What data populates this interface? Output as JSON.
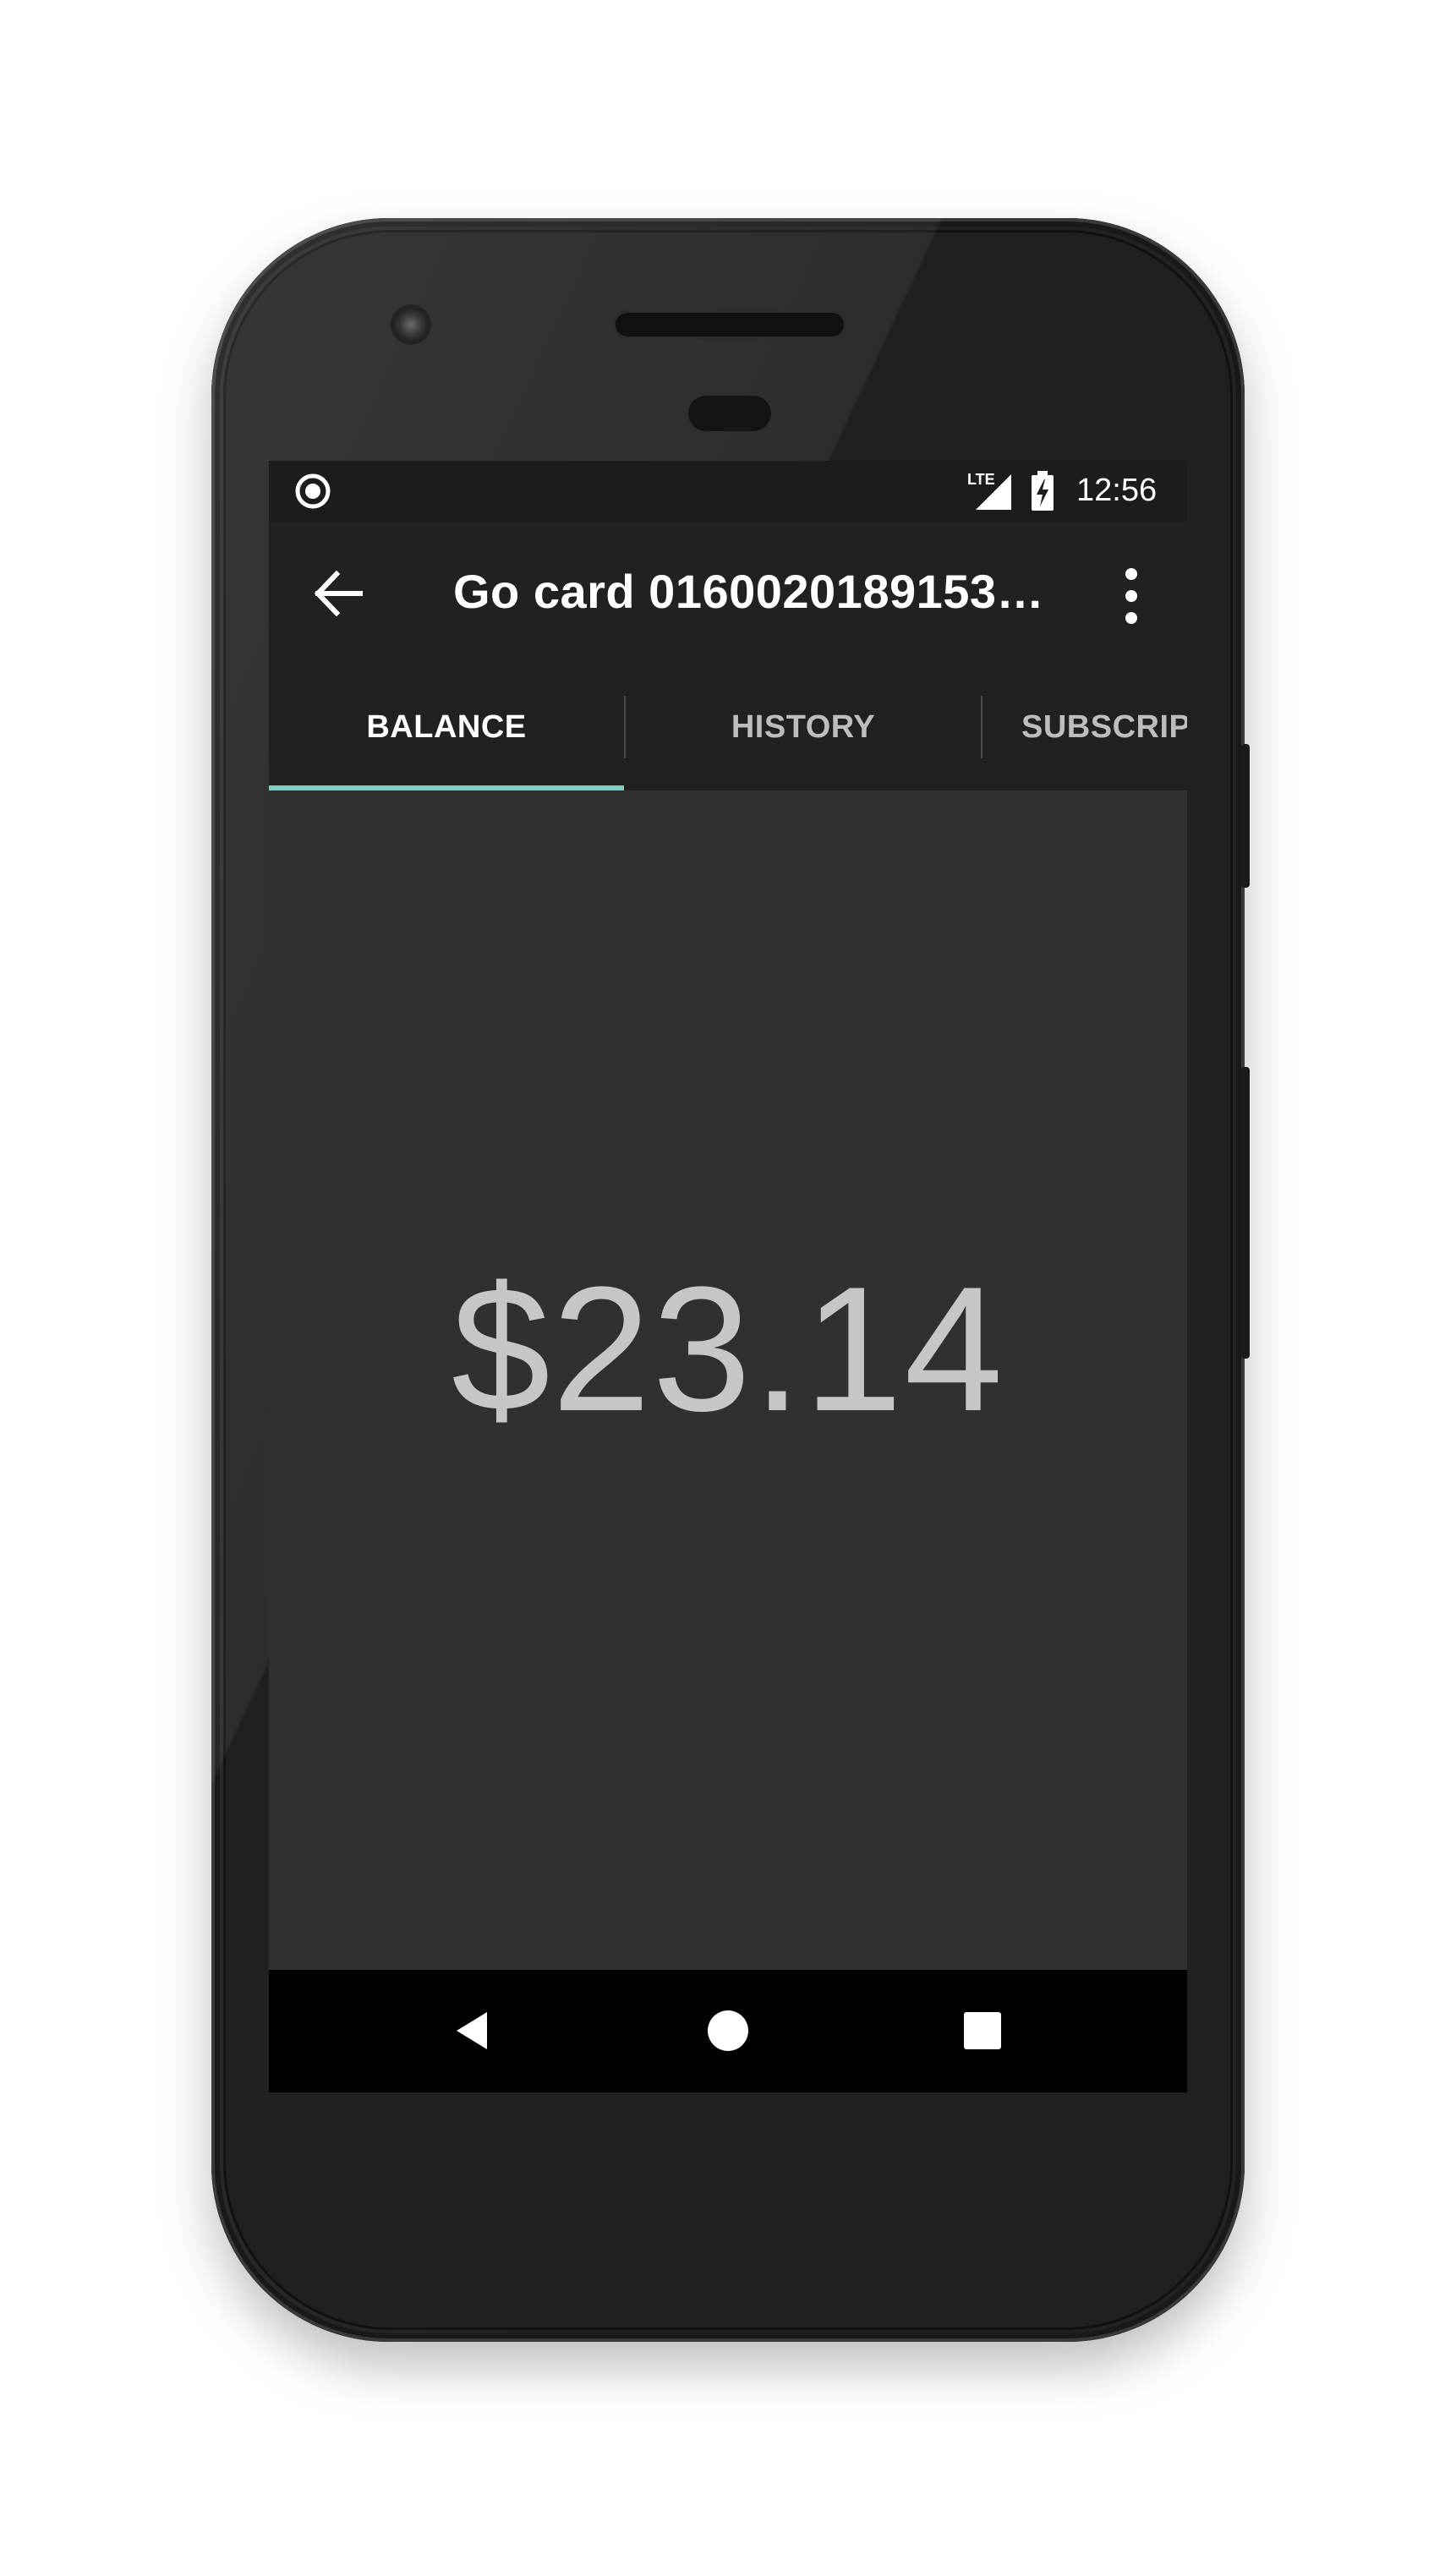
{
  "status_bar": {
    "network_label": "LTE",
    "time": "12:56"
  },
  "app_bar": {
    "title": "Go card 0160020189153…",
    "back_icon": "arrow-back-icon",
    "menu_icon": "more-vert-icon"
  },
  "tabs": [
    {
      "label": "BALANCE",
      "active": true
    },
    {
      "label": "HISTORY",
      "active": false
    },
    {
      "label": "SUBSCRIP",
      "active": false
    }
  ],
  "balance": {
    "amount": "$23.14"
  },
  "nav_bar": {
    "back_icon": "nav-back-icon",
    "home_icon": "nav-home-icon",
    "recents_icon": "nav-recents-icon"
  },
  "colors": {
    "accent": "#80cbc4",
    "app_bar": "#212121",
    "background": "#303030",
    "status_bar": "#1c1c1c",
    "nav_bar": "#000000"
  }
}
